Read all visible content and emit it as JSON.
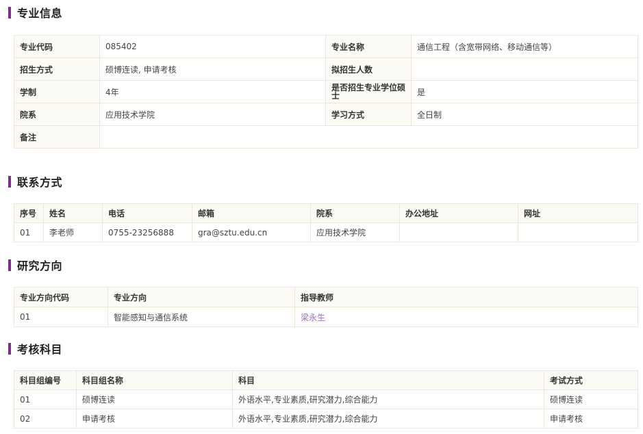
{
  "sections": {
    "info": "专业信息",
    "contact": "联系方式",
    "research": "研究方向",
    "exam": "考核科目"
  },
  "info": {
    "code_label": "专业代码",
    "code": "085402",
    "name_label": "专业名称",
    "name": "通信工程（含宽带网络、移动通信等）",
    "enroll_label": "招生方式",
    "enroll": "硕博连读, 申请考核",
    "plan_label": "拟招生人数",
    "plan": "",
    "length_label": "学制",
    "length": "4年",
    "prof_label": "是否招生专业学位硕士",
    "prof": "是",
    "dept_label": "院系",
    "dept": "应用技术学院",
    "mode_label": "学习方式",
    "mode": "全日制",
    "note_label": "备注",
    "note": ""
  },
  "contact": {
    "headers": [
      "序号",
      "姓名",
      "电话",
      "邮箱",
      "院系",
      "办公地址",
      "网址"
    ],
    "rows": [
      [
        "01",
        "李老师",
        "0755-23256888",
        "gra@sztu.edu.cn",
        "应用技术学院",
        "",
        ""
      ]
    ]
  },
  "research": {
    "headers": [
      "专业方向代码",
      "专业方向",
      "指导教师"
    ],
    "rows": [
      [
        "01",
        "智能感知与通信系统",
        "梁永生"
      ]
    ]
  },
  "exam": {
    "headers": [
      "科目组编号",
      "科目组名称",
      "科目",
      "考试方式"
    ],
    "rows": [
      [
        "01",
        "硕博连读",
        "外语水平,专业素质,研究潜力,综合能力",
        "硕博连读"
      ],
      [
        "02",
        "申请考核",
        "外语水平,专业素质,研究潜力,综合能力",
        "申请考核"
      ]
    ]
  },
  "colors": {
    "accent": "#7b2f86",
    "header_bg": "#fcfaf5",
    "border": "#eee6d6",
    "link": "#9b6fc1"
  }
}
